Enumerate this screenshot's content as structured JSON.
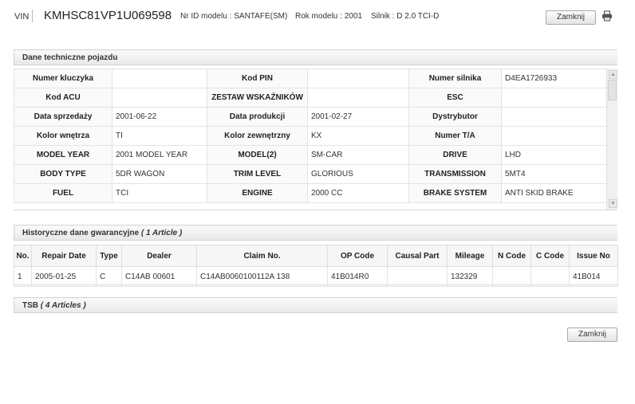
{
  "header": {
    "vin_label": "VIN",
    "vin": "KMHSC81VP1U069598",
    "model_id": "Nr ID modelu : SANTAFE(SM)",
    "model_year": "Rok modelu : 2001",
    "engine": "Silnik : D 2.0 TCI-D",
    "close_label": "Zamknij",
    "print_icon": "printer-icon"
  },
  "tech_section": {
    "title": "Dane techniczne pojazdu",
    "rows": [
      [
        {
          "label": "Numer kluczyka",
          "value": ""
        },
        {
          "label": "Kod PIN",
          "value": ""
        },
        {
          "label": "Numer silnika",
          "value": "D4EA1726933"
        }
      ],
      [
        {
          "label": "Kod ACU",
          "value": ""
        },
        {
          "label": "ZESTAW WSKAŹNIKÓW",
          "value": ""
        },
        {
          "label": "ESC",
          "value": ""
        }
      ],
      [
        {
          "label": "Data sprzedaży",
          "value": "2001-06-22"
        },
        {
          "label": "Data produkcji",
          "value": "2001-02-27"
        },
        {
          "label": "Dystrybutor",
          "value": ""
        }
      ],
      [
        {
          "label": "Kolor wnętrza",
          "value": "TI"
        },
        {
          "label": "Kolor zewnętrzny",
          "value": "KX"
        },
        {
          "label": "Numer T/A",
          "value": ""
        }
      ],
      [
        {
          "label": "MODEL YEAR",
          "value": "2001 MODEL YEAR"
        },
        {
          "label": "MODEL(2)",
          "value": "SM-CAR"
        },
        {
          "label": "DRIVE",
          "value": "LHD"
        }
      ],
      [
        {
          "label": "BODY TYPE",
          "value": "5DR WAGON"
        },
        {
          "label": "TRIM LEVEL",
          "value": "GLORIOUS"
        },
        {
          "label": "TRANSMISSION",
          "value": "5MT4"
        }
      ],
      [
        {
          "label": "FUEL",
          "value": "TCI"
        },
        {
          "label": "ENGINE",
          "value": "2000 CC"
        },
        {
          "label": "BRAKE SYSTEM",
          "value": "ANTI SKID BRAKE"
        }
      ]
    ]
  },
  "warranty_section": {
    "title": "Historyczne dane gwarancyjne",
    "count": "( 1 Article )",
    "columns": [
      "No.",
      "Repair Date",
      "Type",
      "Dealer",
      "Claim No.",
      "OP Code",
      "Causal Part",
      "Mileage",
      "N Code",
      "C Code",
      "Issue No"
    ],
    "rows": [
      [
        "1",
        "2005-01-25",
        "C",
        "C14AB 00601",
        "C14AB0060100112A 138",
        "41B014R0",
        "",
        "132329",
        "",
        "",
        "41B014"
      ]
    ]
  },
  "tsb_section": {
    "title": "TSB",
    "count": "( 4 Articles )"
  },
  "footer": {
    "close_label": "Zamknij"
  }
}
